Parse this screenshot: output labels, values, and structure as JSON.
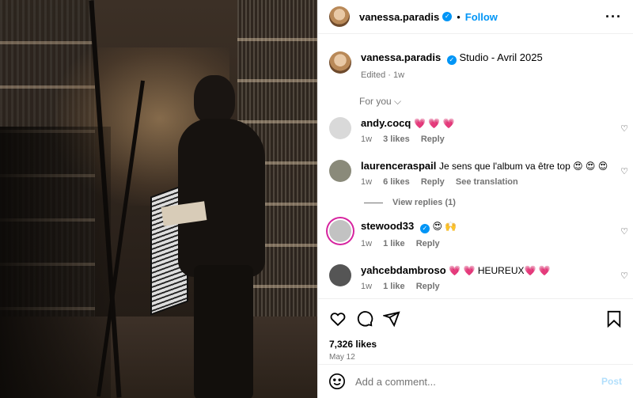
{
  "header": {
    "username": "vanessa.paradis",
    "follow_label": "Follow",
    "separator": "•",
    "more_label": "···"
  },
  "caption": {
    "username": "vanessa.paradis",
    "text": "Studio - Avril 2025",
    "meta": "Edited · 1w"
  },
  "for_you_label": "For you ⌵",
  "comments": [
    {
      "username": "andy.cocq",
      "text": "💗 💗 💗",
      "time": "1w",
      "likes": "3 likes",
      "reply": "Reply",
      "avatar_color": "#d9d9d9"
    },
    {
      "username": "laurenceraspail",
      "text": "Je sens que l'album va être top 😍 😍 😍",
      "time": "1w",
      "likes": "6 likes",
      "reply": "Reply",
      "translate": "See translation",
      "view_replies": "View replies (1)",
      "avatar_color": "#8a8a7a"
    },
    {
      "username": "stewood33",
      "text": "😍 🙌",
      "time": "1w",
      "likes": "1 like",
      "reply": "Reply",
      "avatar_color": "#c2c2c2"
    },
    {
      "username": "yahcebdambroso",
      "text": "💗 💗 HEUREUX💗 💗",
      "time": "1w",
      "likes": "1 like",
      "reply": "Reply",
      "avatar_color": "#555555"
    }
  ],
  "likes_count": "7,326 likes",
  "date": "May 12",
  "add_comment": {
    "placeholder": "Add a comment...",
    "post_label": "Post"
  },
  "colors": {
    "accent": "#0095f6",
    "muted": "#737373",
    "post_disabled": "#b2dffc"
  }
}
